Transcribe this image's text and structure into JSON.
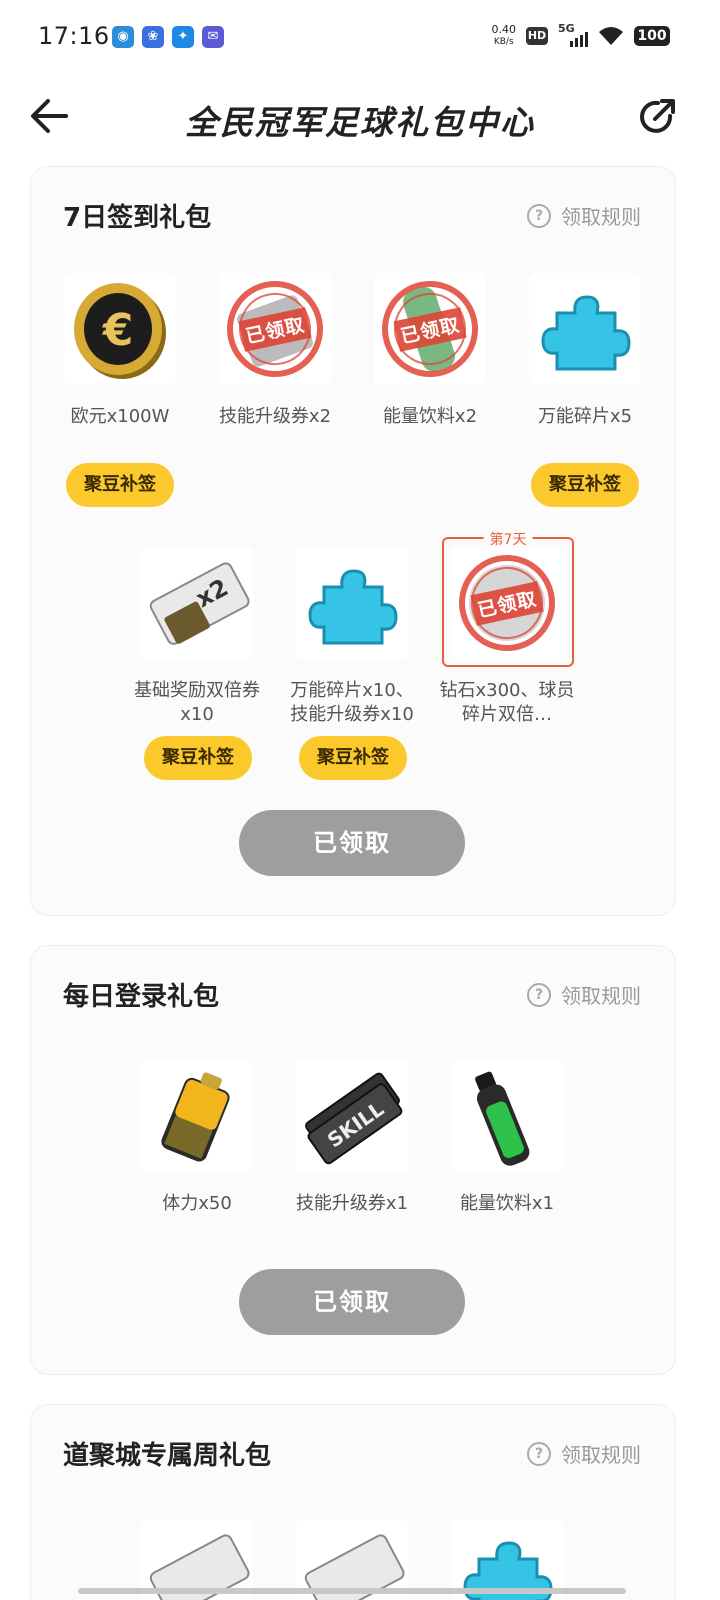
{
  "status_bar": {
    "time": "17:16",
    "net_speed_value": "0.40",
    "net_speed_unit": "KB/s",
    "hd": "HD",
    "network": "5G",
    "battery": "100"
  },
  "header": {
    "title": "全民冠军足球礼包中心"
  },
  "checkin_pack": {
    "title": "7日签到礼包",
    "rules_label": "领取规则",
    "items": [
      {
        "label": "欧元x100W",
        "icon": "euro-coin-icon",
        "claimed": false
      },
      {
        "label": "技能升级券x2",
        "icon": "skill-ticket-icon",
        "claimed": true
      },
      {
        "label": "能量饮料x2",
        "icon": "energy-drink-icon",
        "claimed": true
      },
      {
        "label": "万能碎片x5",
        "icon": "puzzle-piece-icon",
        "claimed": false
      },
      {
        "label": "基础奖励双倍券x10",
        "icon": "double-ticket-icon",
        "claimed": false
      },
      {
        "label": "万能碎片x10、技能升级券x10",
        "icon": "puzzle-piece-icon",
        "claimed": false
      },
      {
        "label": "钻石x300、球员碎片双倍…",
        "icon": "diamond-icon",
        "claimed": true
      }
    ],
    "claimed_stamp": "已领取",
    "resign_label": "聚豆补签",
    "day7_label": "第7天",
    "claim_button": "已领取"
  },
  "daily_pack": {
    "title": "每日登录礼包",
    "rules_label": "领取规则",
    "items": [
      {
        "label": "体力x50",
        "icon": "battery-icon"
      },
      {
        "label": "技能升级券x1",
        "icon": "skill-ticket-icon"
      },
      {
        "label": "能量饮料x1",
        "icon": "energy-drink-icon"
      }
    ],
    "claim_button": "已领取"
  },
  "weekly_pack": {
    "title": "道聚城专属周礼包",
    "rules_label": "领取规则"
  },
  "colors": {
    "accent_yellow": "#fcc92c",
    "claimed_gray": "#9e9e9e",
    "stamp_red": "#de4434",
    "day7_border": "#e8603c"
  }
}
